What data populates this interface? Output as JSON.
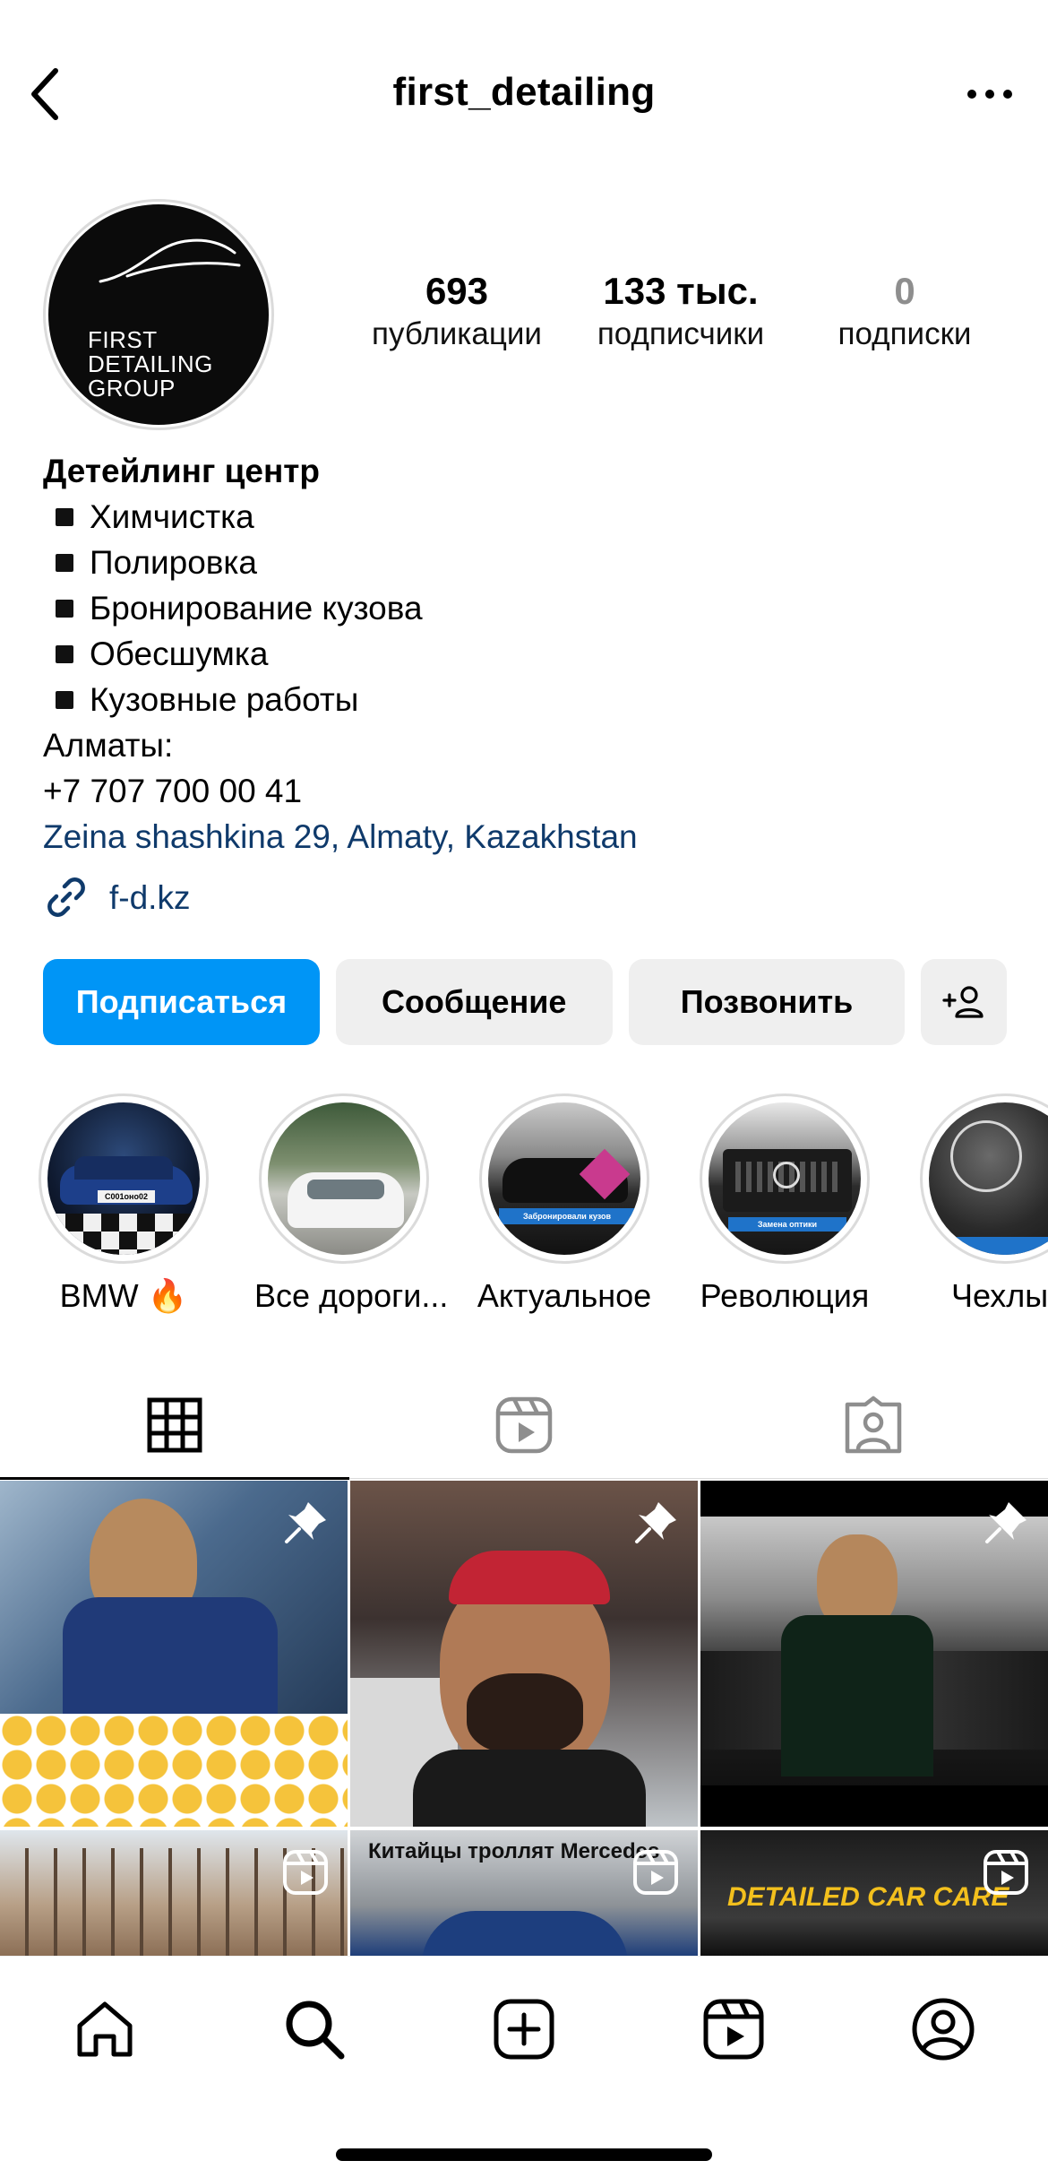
{
  "header": {
    "username": "first_detailing",
    "back_icon": "chevron-left-icon",
    "more_icon": "ellipsis-icon"
  },
  "profile": {
    "avatar_text": [
      "FIRST",
      "DETAILING",
      "GROUP"
    ],
    "stats": [
      {
        "value": "693",
        "label": "публикации"
      },
      {
        "value": "133 тыс.",
        "label": "подписчики"
      },
      {
        "value": "0",
        "label": "подписки"
      }
    ]
  },
  "bio": {
    "name": "Детейлинг центр",
    "items": [
      "Химчистка",
      "Полировка",
      "Бронирование кузова",
      "Обесшумка",
      "Кузовные работы"
    ],
    "city": "Алматы:",
    "phone": "+7 707 700 00 41",
    "location": "Zeina shashkina 29, Almaty, Kazakhstan",
    "website": "f-d.kz"
  },
  "actions": {
    "follow": "Подписаться",
    "message": "Сообщение",
    "call": "Позвонить",
    "add_icon": "add-person-icon"
  },
  "highlights": [
    {
      "label": "BMW 🔥",
      "plate": "С001оно02"
    },
    {
      "label": "Все дороги..."
    },
    {
      "label": "Актуальное",
      "caption": "Забронировали кузов"
    },
    {
      "label": "Революция",
      "caption": "Замена оптики"
    },
    {
      "label": "Чехлы"
    }
  ],
  "tabs": [
    {
      "name": "grid",
      "icon": "grid-icon",
      "active": true
    },
    {
      "name": "reels",
      "icon": "reels-icon",
      "active": false
    },
    {
      "name": "tagged",
      "icon": "tagged-person-icon",
      "active": false
    }
  ],
  "posts": {
    "captions": [
      "Китайцы троллят Mercedes",
      "DETAILED CAR CARE"
    ]
  },
  "bottom_nav": [
    "home-icon",
    "search-icon",
    "create-icon",
    "reels-icon",
    "profile-icon"
  ],
  "colors": {
    "accent": "#0095f6",
    "link": "#0f3a6b",
    "button_grey": "#efefef",
    "caption_yellow": "#f3c01d"
  }
}
